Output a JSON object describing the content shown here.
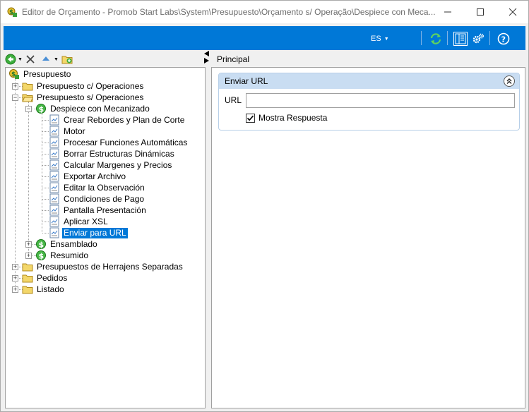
{
  "window": {
    "title": "Editor de Orçamento - Promob Start Labs\\System\\Presupuesto\\Orçamento s/ Operação\\Despiece con Meca...",
    "minimize_icon": "minimize-icon",
    "maximize_icon": "maximize-icon",
    "close_icon": "close-icon"
  },
  "toolbar": {
    "language": "ES",
    "icons": [
      "refresh-icon",
      "layout-icon",
      "settings-icon",
      "help-icon"
    ],
    "accent": "#0078d7"
  },
  "left_toolbar": {
    "icons": [
      "back-icon",
      "delete-icon",
      "move-up-icon",
      "add-folder-icon"
    ]
  },
  "tree": {
    "root": "Presupuesto",
    "items": [
      {
        "label": "Presupuesto c/ Operaciones"
      },
      {
        "label": "Presupuesto s/ Operaciones"
      },
      {
        "label": "Despiece con Mecanizado"
      },
      {
        "label": "Crear Rebordes y Plan de Corte"
      },
      {
        "label": "Motor"
      },
      {
        "label": "Procesar Funciones Automáticas"
      },
      {
        "label": "Borrar Estructuras Dinámicas"
      },
      {
        "label": "Calcular Margenes y Precios"
      },
      {
        "label": "Exportar Archivo"
      },
      {
        "label": "Editar la Observación"
      },
      {
        "label": "Condiciones de Pago"
      },
      {
        "label": "Pantalla Presentación"
      },
      {
        "label": "Aplicar XSL"
      },
      {
        "label": "Enviar para URL"
      },
      {
        "label": "Ensamblado"
      },
      {
        "label": "Resumido"
      },
      {
        "label": "Presupuestos de Herrajens Separadas"
      },
      {
        "label": "Pedidos"
      },
      {
        "label": "Listado"
      }
    ],
    "selected_label": "Enviar para URL"
  },
  "right": {
    "tab": "Principal",
    "group_title": "Enviar URL",
    "url_label": "URL",
    "url_value": "",
    "checkbox_label": "Mostra Respuesta",
    "checkbox_checked": true
  }
}
